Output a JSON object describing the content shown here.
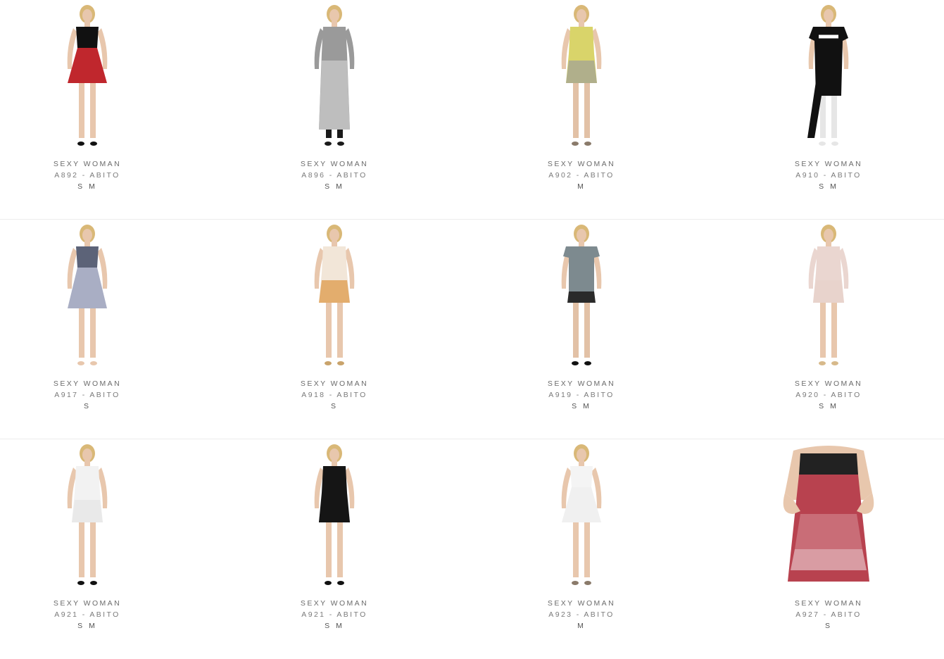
{
  "products": [
    {
      "brand": "SEXY WOMAN",
      "name": "A892 - ABITO",
      "sizes": "S M",
      "colors": {
        "top": "#111111",
        "bottom": "#c0272d",
        "skin": "#e8c7ad",
        "legs": "#e8c7ad",
        "shoes": "#111111"
      },
      "style": "short-flare"
    },
    {
      "brand": "SEXY WOMAN",
      "name": "A896 - ABITO",
      "sizes": "S M",
      "colors": {
        "top": "#9a9a9a",
        "bottom": "#c4c4c4",
        "skin": "#e8c7ad",
        "legs": "#1a1a1a",
        "shoes": "#1a1a1a"
      },
      "style": "long-sleeve"
    },
    {
      "brand": "SEXY WOMAN",
      "name": "A902 - ABITO",
      "sizes": "M",
      "colors": {
        "top": "#d9d46a",
        "bottom": "#a8a890",
        "skin": "#e8c7ad",
        "legs": "#e2c1a6",
        "shoes": "#8a7a6a"
      },
      "style": "short-fitted"
    },
    {
      "brand": "SEXY WOMAN",
      "name": "A910 - ABITO",
      "sizes": "S M",
      "colors": {
        "top": "#111111",
        "bottom": "#111111",
        "skin": "#e8c7ad",
        "legs": "#e6e6e6",
        "shoes": "#e6e6e6"
      },
      "style": "tshirt-long"
    },
    {
      "brand": "SEXY WOMAN",
      "name": "A917 - ABITO",
      "sizes": "S",
      "colors": {
        "top": "#5c6378",
        "bottom": "#a9aec4",
        "skin": "#e8c7ad",
        "legs": "#e8c7ad",
        "shoes": "#e8c7ad"
      },
      "style": "strapless-flare"
    },
    {
      "brand": "SEXY WOMAN",
      "name": "A918 - ABITO",
      "sizes": "S",
      "colors": {
        "top": "#f2e6d8",
        "bottom": "#e0a25a",
        "skin": "#e8c7ad",
        "legs": "#e8c7ad",
        "shoes": "#c9a36b"
      },
      "style": "short-fitted"
    },
    {
      "brand": "SEXY WOMAN",
      "name": "A919 - ABITO",
      "sizes": "S M",
      "colors": {
        "top": "#7d8a8f",
        "bottom": "#2a2a2a",
        "skin": "#e8c7ad",
        "legs": "#e2c1a6",
        "shoes": "#111111"
      },
      "style": "short-tee"
    },
    {
      "brand": "SEXY WOMAN",
      "name": "A920 - ABITO",
      "sizes": "S M",
      "colors": {
        "top": "#ead6d0",
        "bottom": "#e7d2cb",
        "skin": "#e8c7ad",
        "legs": "#e8c7ad",
        "shoes": "#d7b98a"
      },
      "style": "long-sleeve-short"
    },
    {
      "brand": "SEXY WOMAN",
      "name": "A921 - ABITO",
      "sizes": "S M",
      "colors": {
        "top": "#f2f2f2",
        "bottom": "#e8e8e8",
        "skin": "#e8c7ad",
        "legs": "#e8c7ad",
        "shoes": "#111111"
      },
      "style": "short-fitted"
    },
    {
      "brand": "SEXY WOMAN",
      "name": "A921 - ABITO",
      "sizes": "S M",
      "colors": {
        "top": "#151515",
        "bottom": "#151515",
        "skin": "#e8c7ad",
        "legs": "#e8c7ad",
        "shoes": "#111111"
      },
      "style": "short-fitted"
    },
    {
      "brand": "SEXY WOMAN",
      "name": "A923 - ABITO",
      "sizes": "M",
      "colors": {
        "top": "#f4f4f4",
        "bottom": "#f0f0f0",
        "skin": "#e8c7ad",
        "legs": "#e8c7ad",
        "shoes": "#8a7a6a"
      },
      "style": "short-flare"
    },
    {
      "brand": "SEXY WOMAN",
      "name": "A927 - ABITO",
      "sizes": "S",
      "colors": {
        "top": "#222222",
        "bottom": "#b8424f",
        "skin": "#e8c7ad",
        "legs": "#e8c7ad",
        "shoes": "#e8c7ad"
      },
      "style": "closeup"
    }
  ]
}
